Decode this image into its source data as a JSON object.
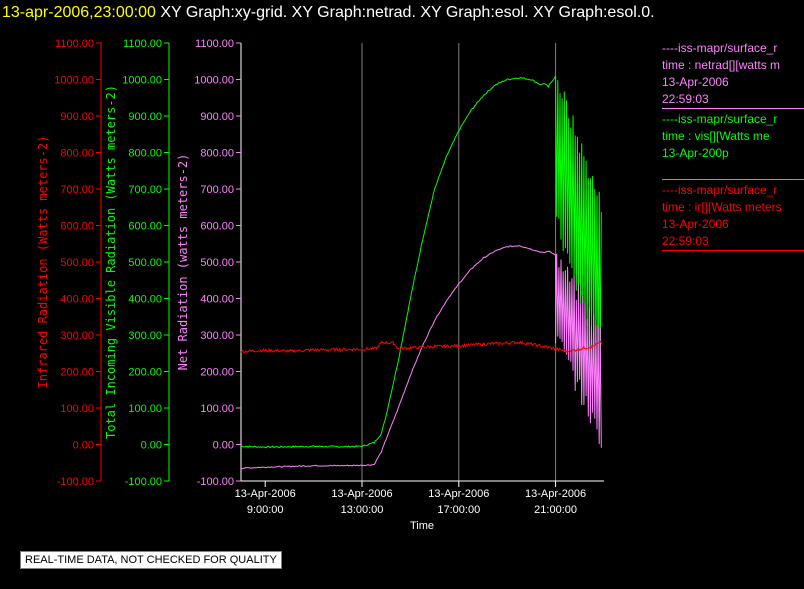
{
  "header": {
    "timestamp": "13-apr-2006,23:00:00",
    "graphs": "XY Graph:xy-grid.  XY Graph:netrad.  XY Graph:esol.  XY Graph:esol.0."
  },
  "colors": {
    "ir": "#ff0000",
    "vis": "#00ff00",
    "net": "#ff80ff",
    "axis": "#ffffff",
    "grid": "#808080",
    "bg": "#000000"
  },
  "chart_data": {
    "type": "line",
    "xlabel": "Time",
    "x_ticks": [
      {
        "date": "13-Apr-2006",
        "time": "9:00:00",
        "hour": 9
      },
      {
        "date": "13-Apr-2006",
        "time": "13:00:00",
        "hour": 13
      },
      {
        "date": "13-Apr-2006",
        "time": "17:00:00",
        "hour": 17
      },
      {
        "date": "13-Apr-2006",
        "time": "21:00:00",
        "hour": 21
      }
    ],
    "x_range_hours": [
      8.0,
      23.0
    ],
    "y_axes": [
      {
        "id": "ir",
        "label": "Infrared Radiation (Watts meters-2)",
        "color": "#ff0000",
        "ylim": [
          -100,
          1100
        ]
      },
      {
        "id": "vis",
        "label": "Total Incoming Visible Radiation (Watts meters-2)",
        "color": "#00ff00",
        "ylim": [
          -100,
          1100
        ]
      },
      {
        "id": "net",
        "label": "Net Radiation (watts meters-2)",
        "color": "#ff80ff",
        "ylim": [
          -100,
          1100
        ]
      }
    ],
    "y_ticks": [
      -100,
      0,
      100,
      200,
      300,
      400,
      500,
      600,
      700,
      800,
      900,
      1000,
      1100
    ],
    "series": [
      {
        "axis": "ir",
        "color": "#ff0000",
        "points": [
          [
            8.0,
            255
          ],
          [
            9.0,
            258
          ],
          [
            10.0,
            256
          ],
          [
            11.0,
            259
          ],
          [
            12.0,
            260
          ],
          [
            13.0,
            261
          ],
          [
            13.6,
            263
          ],
          [
            13.8,
            280
          ],
          [
            14.3,
            278
          ],
          [
            14.5,
            262
          ],
          [
            15.0,
            265
          ],
          [
            16.0,
            268
          ],
          [
            17.0,
            270
          ],
          [
            18.0,
            275
          ],
          [
            19.0,
            278
          ],
          [
            19.5,
            280
          ],
          [
            20.0,
            275
          ],
          [
            21.0,
            262
          ],
          [
            21.5,
            255
          ],
          [
            22.0,
            262
          ],
          [
            22.5,
            268
          ],
          [
            22.9,
            280
          ]
        ]
      },
      {
        "axis": "vis",
        "color": "#00ff00",
        "points": [
          [
            8.0,
            -5
          ],
          [
            9.0,
            -7
          ],
          [
            10.0,
            -6
          ],
          [
            11.0,
            -5
          ],
          [
            12.0,
            -6
          ],
          [
            13.0,
            -5
          ],
          [
            13.5,
            5
          ],
          [
            13.8,
            30
          ],
          [
            14.0,
            80
          ],
          [
            14.5,
            230
          ],
          [
            15.0,
            400
          ],
          [
            15.5,
            560
          ],
          [
            16.0,
            700
          ],
          [
            16.5,
            790
          ],
          [
            17.0,
            860
          ],
          [
            17.5,
            915
          ],
          [
            18.0,
            955
          ],
          [
            18.5,
            985
          ],
          [
            19.0,
            1000
          ],
          [
            19.5,
            1005
          ],
          [
            20.0,
            1000
          ],
          [
            20.4,
            985
          ],
          [
            20.5,
            990
          ],
          [
            20.7,
            980
          ],
          [
            21.0,
            1010
          ]
        ]
      },
      {
        "axis": "net",
        "color": "#ff80ff",
        "points": [
          [
            8.0,
            -65
          ],
          [
            9.0,
            -62
          ],
          [
            10.0,
            -60
          ],
          [
            11.0,
            -58
          ],
          [
            12.0,
            -58
          ],
          [
            13.0,
            -57
          ],
          [
            13.5,
            -55
          ],
          [
            13.8,
            -20
          ],
          [
            14.0,
            15
          ],
          [
            14.5,
            100
          ],
          [
            15.0,
            190
          ],
          [
            15.5,
            270
          ],
          [
            16.0,
            340
          ],
          [
            16.5,
            395
          ],
          [
            17.0,
            440
          ],
          [
            17.5,
            480
          ],
          [
            18.0,
            510
          ],
          [
            18.5,
            530
          ],
          [
            19.0,
            542
          ],
          [
            19.5,
            545
          ],
          [
            20.0,
            535
          ],
          [
            20.5,
            525
          ],
          [
            20.7,
            530
          ],
          [
            21.0,
            520
          ]
        ]
      }
    ],
    "oscillation": {
      "start_hour": 21.0,
      "end_hour": 22.9,
      "vis_high": [
        1010,
        650
      ],
      "vis_low": [
        620,
        200
      ],
      "net_high": [
        520,
        300
      ],
      "net_low": [
        300,
        10
      ]
    }
  },
  "legend": [
    {
      "title": "----iss-mapr/surface_r",
      "line1": "time : netrad[][watts m",
      "date": "13-Apr-2006",
      "time": "22:59:03",
      "color": "#ff80ff"
    },
    {
      "title": "----iss-mapr/surface_r",
      "line1": "time : vis[][Watts me",
      "date": "13-Apr-200p",
      "time": "",
      "color": "#00ff00"
    },
    {
      "title": "----iss-mapr/surface_r",
      "line1": "time : ir[][Watts meters",
      "date": "13-Apr-2006",
      "time": "22:59:03",
      "color": "#ff0000"
    }
  ],
  "footer": {
    "notice": "REAL-TIME DATA, NOT CHECKED FOR QUALITY"
  }
}
